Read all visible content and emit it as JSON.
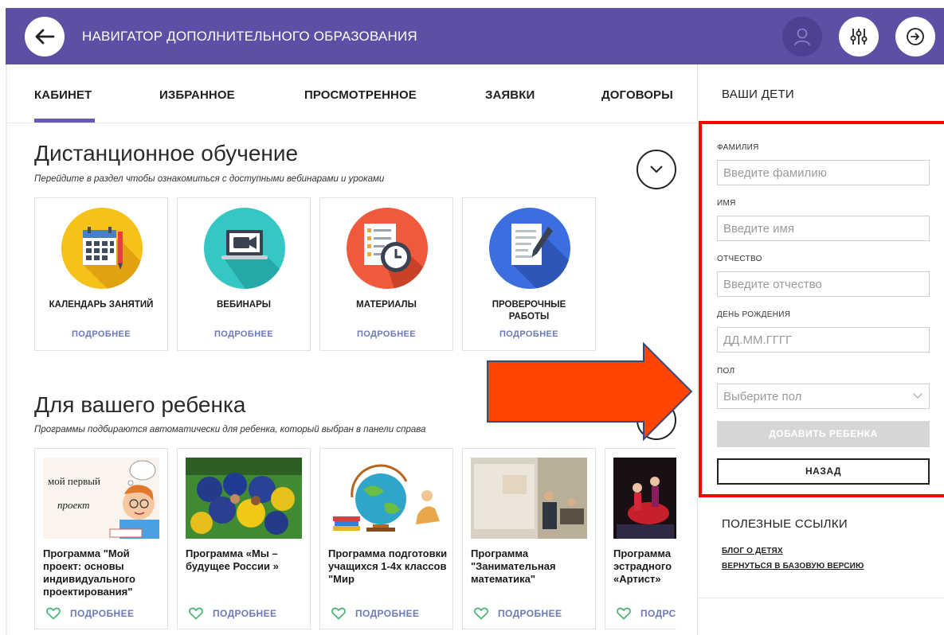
{
  "header": {
    "title": "НАВИГАТОР ДОПОЛНИТЕЛЬНОГО ОБРАЗОВАНИЯ",
    "icons": [
      "back-arrow-icon",
      "user-icon",
      "filter-sliders-icon",
      "exit-arrow-icon"
    ],
    "brand_color": "#5f4ea6"
  },
  "tabs": [
    {
      "label": "КАБИНЕТ",
      "active": true
    },
    {
      "label": "ИЗБРАННОЕ"
    },
    {
      "label": "ПРОСМОТРЕННОЕ"
    },
    {
      "label": "ЗАЯВКИ"
    },
    {
      "label": "ДОГОВОРЫ"
    }
  ],
  "distance": {
    "title": "Дистанционное обучение",
    "subtitle": "Перейдите в раздел чтобы ознакомиться с доступными вебинарами и уроками",
    "cards": [
      {
        "title": "КАЛЕНДАРЬ ЗАНЯТИЙ",
        "more": "ПОДРОБНЕЕ",
        "icon": "calendar-icon"
      },
      {
        "title": "ВЕБИНАРЫ",
        "more": "ПОДРОБНЕЕ",
        "icon": "webinar-icon"
      },
      {
        "title": "МАТЕРИАЛЫ",
        "more": "ПОДРОБНЕЕ",
        "icon": "materials-clock-icon"
      },
      {
        "title": "ПРОВЕРОЧНЫЕ РАБОТЫ",
        "more": "ПОДРОБНЕЕ",
        "icon": "test-document-icon"
      }
    ]
  },
  "child": {
    "title": "Для вашего ребенка",
    "subtitle": "Программы подбираются автоматически для ребенка, который выбран в панели справа",
    "programs": [
      {
        "title": "Программа \"Мой проект: основы индивидуального проектирования\"",
        "more": "ПОДРОБНЕЕ",
        "image_text_1": "мой первый",
        "image_text_2": "проект"
      },
      {
        "title": "Программа «Мы – будущее России »",
        "more": "ПОДРОБНЕЕ"
      },
      {
        "title": "Программа подготовки учащихся 1-4х классов \"Мир",
        "more": "ПОДРОБНЕЕ"
      },
      {
        "title": "Программа \"Занимательная математика\"",
        "more": "ПОДРОБНЕЕ"
      },
      {
        "title": "Программа эстрадного «Артист»",
        "more": "ПОДРС"
      }
    ]
  },
  "children_panel": {
    "title": "ВАШИ ДЕТИ",
    "fields": [
      {
        "label": "ФАМИЛИЯ",
        "placeholder": "Введите фамилию",
        "value": ""
      },
      {
        "label": "ИМЯ",
        "placeholder": "Введите имя",
        "value": ""
      },
      {
        "label": "ОТЧЕСТВО",
        "placeholder": "Введите отчество",
        "value": ""
      },
      {
        "label": "ДЕНЬ РОЖДЕНИЯ",
        "placeholder": "ДД.ММ.ГГГГ",
        "value": ""
      }
    ],
    "gender": {
      "label": "ПОЛ",
      "placeholder": "Выберите пол"
    },
    "add_button": "ДОБАВИТЬ РЕБЕНКА",
    "back_button": "НАЗАД",
    "highlight_color": "#ff0000"
  },
  "links": {
    "title": "ПОЛЕЗНЫЕ ССЫЛКИ",
    "items": [
      "БЛОГ О ДЕТЯХ",
      "ВЕРНУТЬСЯ В БАЗОВУЮ ВЕРСИЮ"
    ]
  },
  "annotation": {
    "arrow_color": "#ff4500"
  }
}
